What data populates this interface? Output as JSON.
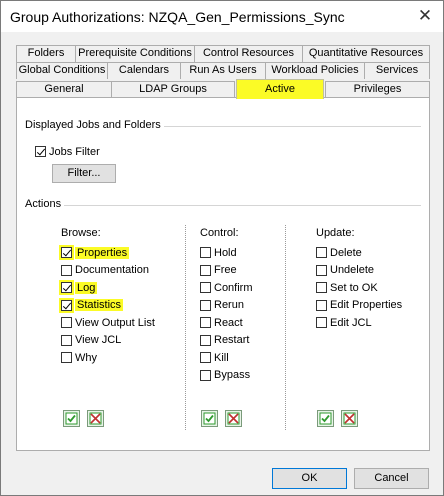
{
  "window": {
    "title": "Group Authorizations: NZQA_Gen_Permissions_Sync",
    "close_glyph": "✕"
  },
  "tabs": {
    "row1": [
      "Folders",
      "Prerequisite Conditions",
      "Control Resources",
      "Quantitative Resources"
    ],
    "row2": [
      "Global Conditions",
      "Calendars",
      "Run As Users",
      "Workload Policies",
      "Services"
    ],
    "row3": [
      "General",
      "LDAP Groups",
      "Active",
      "Privileges"
    ],
    "active": "Active"
  },
  "displayed": {
    "group_label": "Displayed Jobs and Folders",
    "jobs_filter_label": "Jobs Filter",
    "jobs_filter_checked": true,
    "filter_button": "Filter..."
  },
  "actions": {
    "group_label": "Actions",
    "browse": {
      "header": "Browse:",
      "items": [
        {
          "label": "Properties",
          "checked": true,
          "highlight": true
        },
        {
          "label": "Documentation",
          "checked": false,
          "highlight": false
        },
        {
          "label": "Log",
          "checked": true,
          "highlight": true
        },
        {
          "label": "Statistics",
          "checked": true,
          "highlight": true
        },
        {
          "label": "View Output List",
          "checked": false,
          "highlight": false
        },
        {
          "label": "View JCL",
          "checked": false,
          "highlight": false
        },
        {
          "label": "Why",
          "checked": false,
          "highlight": false
        }
      ]
    },
    "control": {
      "header": "Control:",
      "items": [
        {
          "label": "Hold",
          "checked": false
        },
        {
          "label": "Free",
          "checked": false
        },
        {
          "label": "Confirm",
          "checked": false
        },
        {
          "label": "Rerun",
          "checked": false
        },
        {
          "label": "React",
          "checked": false
        },
        {
          "label": "Restart",
          "checked": false
        },
        {
          "label": "Kill",
          "checked": false
        },
        {
          "label": "Bypass",
          "checked": false
        }
      ]
    },
    "update": {
      "header": "Update:",
      "items": [
        {
          "label": "Delete",
          "checked": false
        },
        {
          "label": "Undelete",
          "checked": false
        },
        {
          "label": "Set to OK",
          "checked": false
        },
        {
          "label": "Edit Properties",
          "checked": false
        },
        {
          "label": "Edit JCL",
          "checked": false
        }
      ]
    },
    "icons": [
      "select-all-icon",
      "clear-all-icon"
    ]
  },
  "footer": {
    "ok": "OK",
    "cancel": "Cancel"
  },
  "colors": {
    "highlight": "#fbfb26",
    "icon_green": "#2e9a2e",
    "icon_red": "#c03030"
  }
}
